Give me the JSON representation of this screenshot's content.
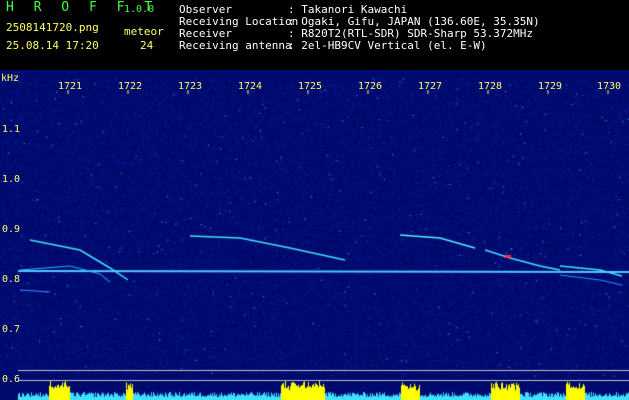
{
  "header": {
    "app_name": "H R O F F T",
    "version": "1.0.0",
    "filename": "2508141720.png",
    "datetime": "25.08.14 17:20",
    "meteor_label": "meteor",
    "meteor_count": "24",
    "info_labels": [
      "Observer",
      "Receiving Location",
      "Receiver",
      "Receiving antenna"
    ],
    "info_values": [
      ": Takanori Kawachi",
      ": Ogaki, Gifu, JAPAN (136.60E, 35.35N)",
      ": R820T2(RTL-SDR) SDR-Sharp 53.372MHz",
      ": 2el-HB9CV Vertical (el. E-W)"
    ]
  },
  "spectrogram": {
    "y_unit": "kHz",
    "x_ticks": [
      "1721",
      "1722",
      "1723",
      "1724",
      "1725",
      "1726",
      "1727",
      "1728",
      "1729",
      "1730"
    ],
    "y_ticks": [
      "1.1",
      "1.0",
      "0.9",
      "0.8",
      "0.7",
      "0.6"
    ],
    "colors": {
      "background": "#000a6e",
      "axis_text": "#ffff66",
      "signal": "#40e0ff",
      "bar": "#ffff00"
    }
  }
}
